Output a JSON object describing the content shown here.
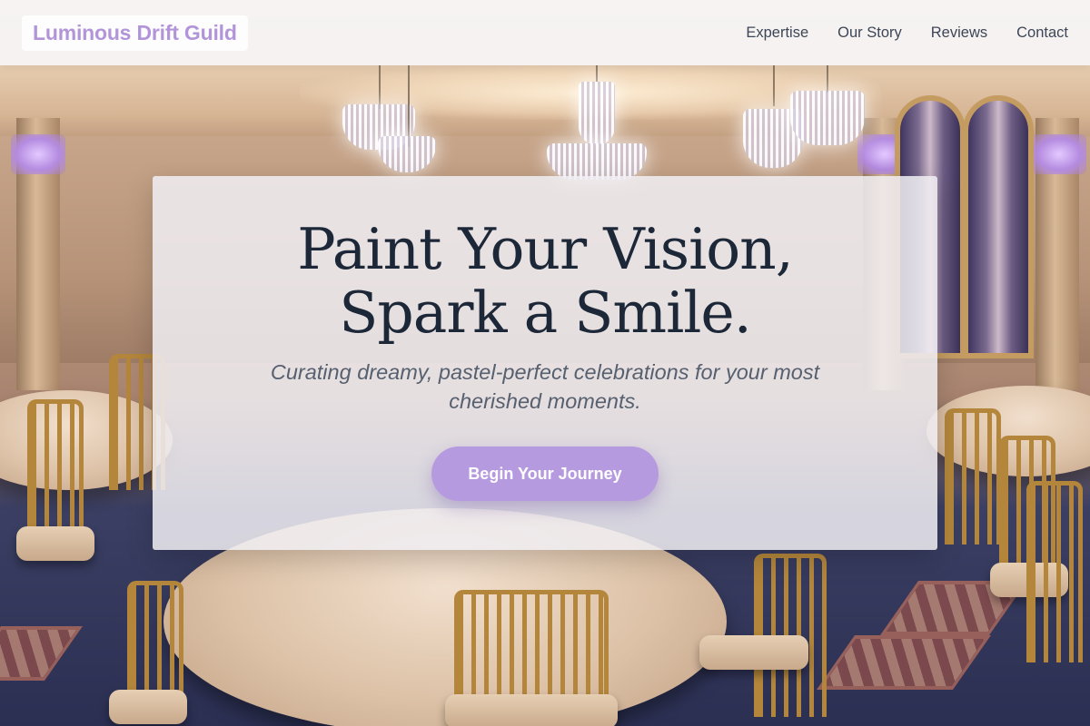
{
  "header": {
    "brand": "Luminous Drift Guild",
    "nav": [
      "Expertise",
      "Our Story",
      "Reviews",
      "Contact"
    ]
  },
  "hero": {
    "title_line1": "Paint Your Vision,",
    "title_line2": "Spark a Smile.",
    "subtitle": "Curating dreamy, pastel-perfect celebrations for your most cherished moments.",
    "cta_label": "Begin Your Journey"
  },
  "colors": {
    "brand": "#b295d9",
    "accent_button": "#b69ae0",
    "title_text": "#1c2738",
    "nav_text": "#3d4656"
  }
}
